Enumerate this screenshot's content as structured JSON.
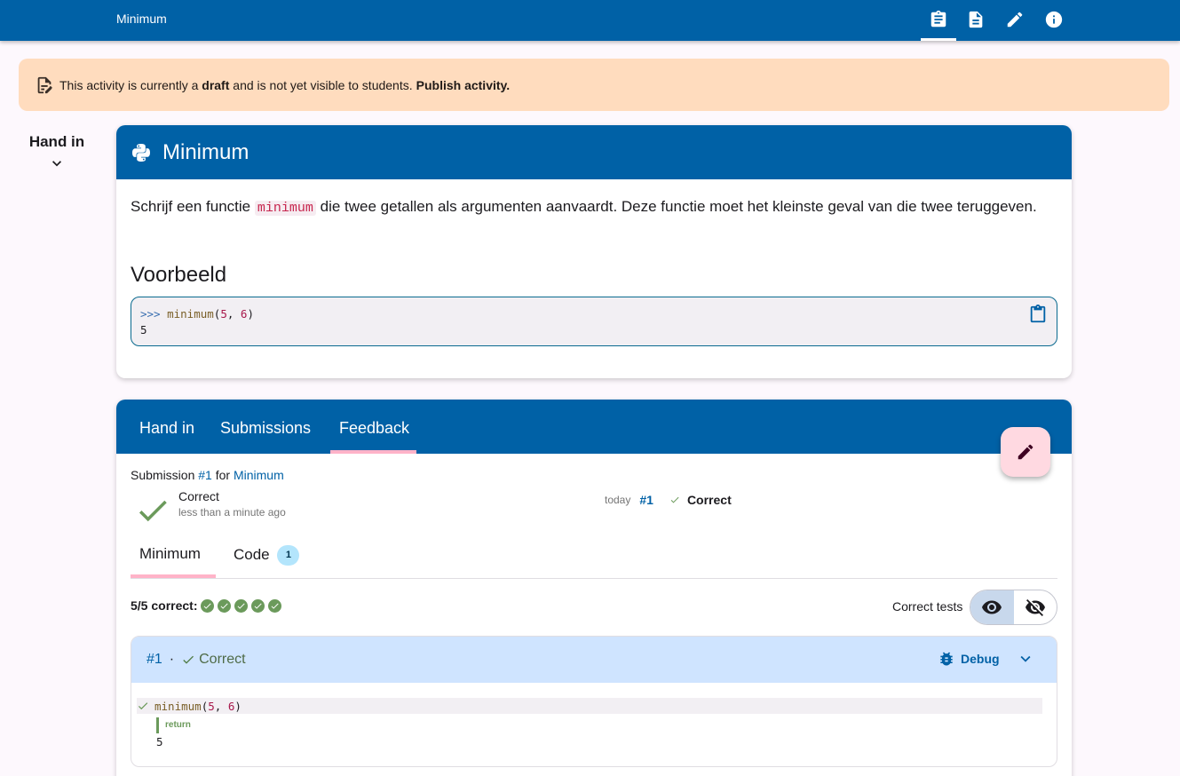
{
  "topbar": {
    "title": "Minimum"
  },
  "draft": {
    "text_before": "This activity is currently a",
    "draft_word": "draft",
    "text_after": "and is not yet visible to students.",
    "publish": "Publish activity."
  },
  "side": {
    "label": "Hand in"
  },
  "exercise": {
    "title": "Minimum",
    "desc_before": "Schrijf een functie",
    "desc_code": "minimum",
    "desc_after": "die twee getallen als argumenten aanvaardt. Deze functie moet het kleinste geval van die twee teruggeven.",
    "example_heading": "Voorbeeld",
    "example": {
      "prompt": ">>>",
      "fn": "minimum",
      "arg1": "5",
      "arg2": "6",
      "output": "5"
    }
  },
  "tabs": [
    "Hand in",
    "Submissions",
    "Feedback"
  ],
  "submission": {
    "prefix": "Submission",
    "number": "#1",
    "for": "for",
    "exercise": "Minimum",
    "status": "Correct",
    "time": "less than a minute ago",
    "meta_today": "today",
    "meta_id": "#1",
    "meta_status": "Correct"
  },
  "subtabs": {
    "minimum": "Minimum",
    "code": "Code",
    "code_badge": "1"
  },
  "results": {
    "summary": "5/5 correct:",
    "correct_count": 5,
    "correct_tests_label": "Correct tests"
  },
  "testcase": {
    "id": "#1",
    "sep": "·",
    "status": "Correct",
    "debug": "Debug",
    "call_fn": "minimum",
    "call_arg1": "5",
    "call_arg2": "6",
    "return_label": "return",
    "return_value": "5"
  },
  "colors": {
    "primary": "#0061a6",
    "success": "#6b9a5b",
    "draft_bg": "#ffdcbe",
    "accent": "#ffb3c8"
  }
}
